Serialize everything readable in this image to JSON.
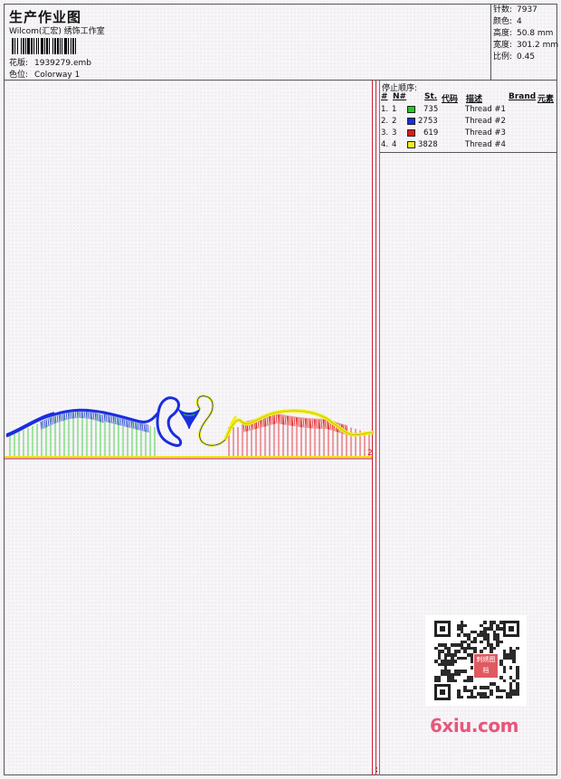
{
  "header": {
    "title": "生产作业图",
    "subtitle": "Wilcom(汇宏) 绣饰工作室",
    "design_label": "花版:",
    "design_value": "1939279.emb",
    "colorway_label": "色位:",
    "colorway_value": "Colorway 1"
  },
  "stats": [
    {
      "label": "针数:",
      "value": "7937"
    },
    {
      "label": "颜色:",
      "value": "4"
    },
    {
      "label": "高度:",
      "value": "50.8 mm"
    },
    {
      "label": "宽度:",
      "value": "301.2 mm"
    },
    {
      "label": "比例:",
      "value": "0.45"
    }
  ],
  "thread_table": {
    "title": "停止顺序:",
    "headers": [
      "#",
      "N#",
      "St.",
      "代码",
      "描述",
      "Brand",
      "元素"
    ],
    "rows": [
      {
        "idx": "1.",
        "n": "1",
        "code": "735",
        "desc": "Thread #1",
        "color": "#22cc22"
      },
      {
        "idx": "2.",
        "n": "2",
        "code": "2753",
        "desc": "Thread #2",
        "color": "#1a2ee0"
      },
      {
        "idx": "3.",
        "n": "3",
        "code": "619",
        "desc": "Thread #3",
        "color": "#e01a1a"
      },
      {
        "idx": "4.",
        "n": "4",
        "code": "3828",
        "desc": "Thread #4",
        "color": "#f0f020"
      }
    ]
  },
  "design_marker": "2",
  "bottom_marker": ":",
  "qr": {
    "logo_text": "刺绣图档"
  },
  "watermark": "6xiu.com",
  "colors": {
    "guide_line": "#d01818",
    "baseline": "#f0e020"
  }
}
